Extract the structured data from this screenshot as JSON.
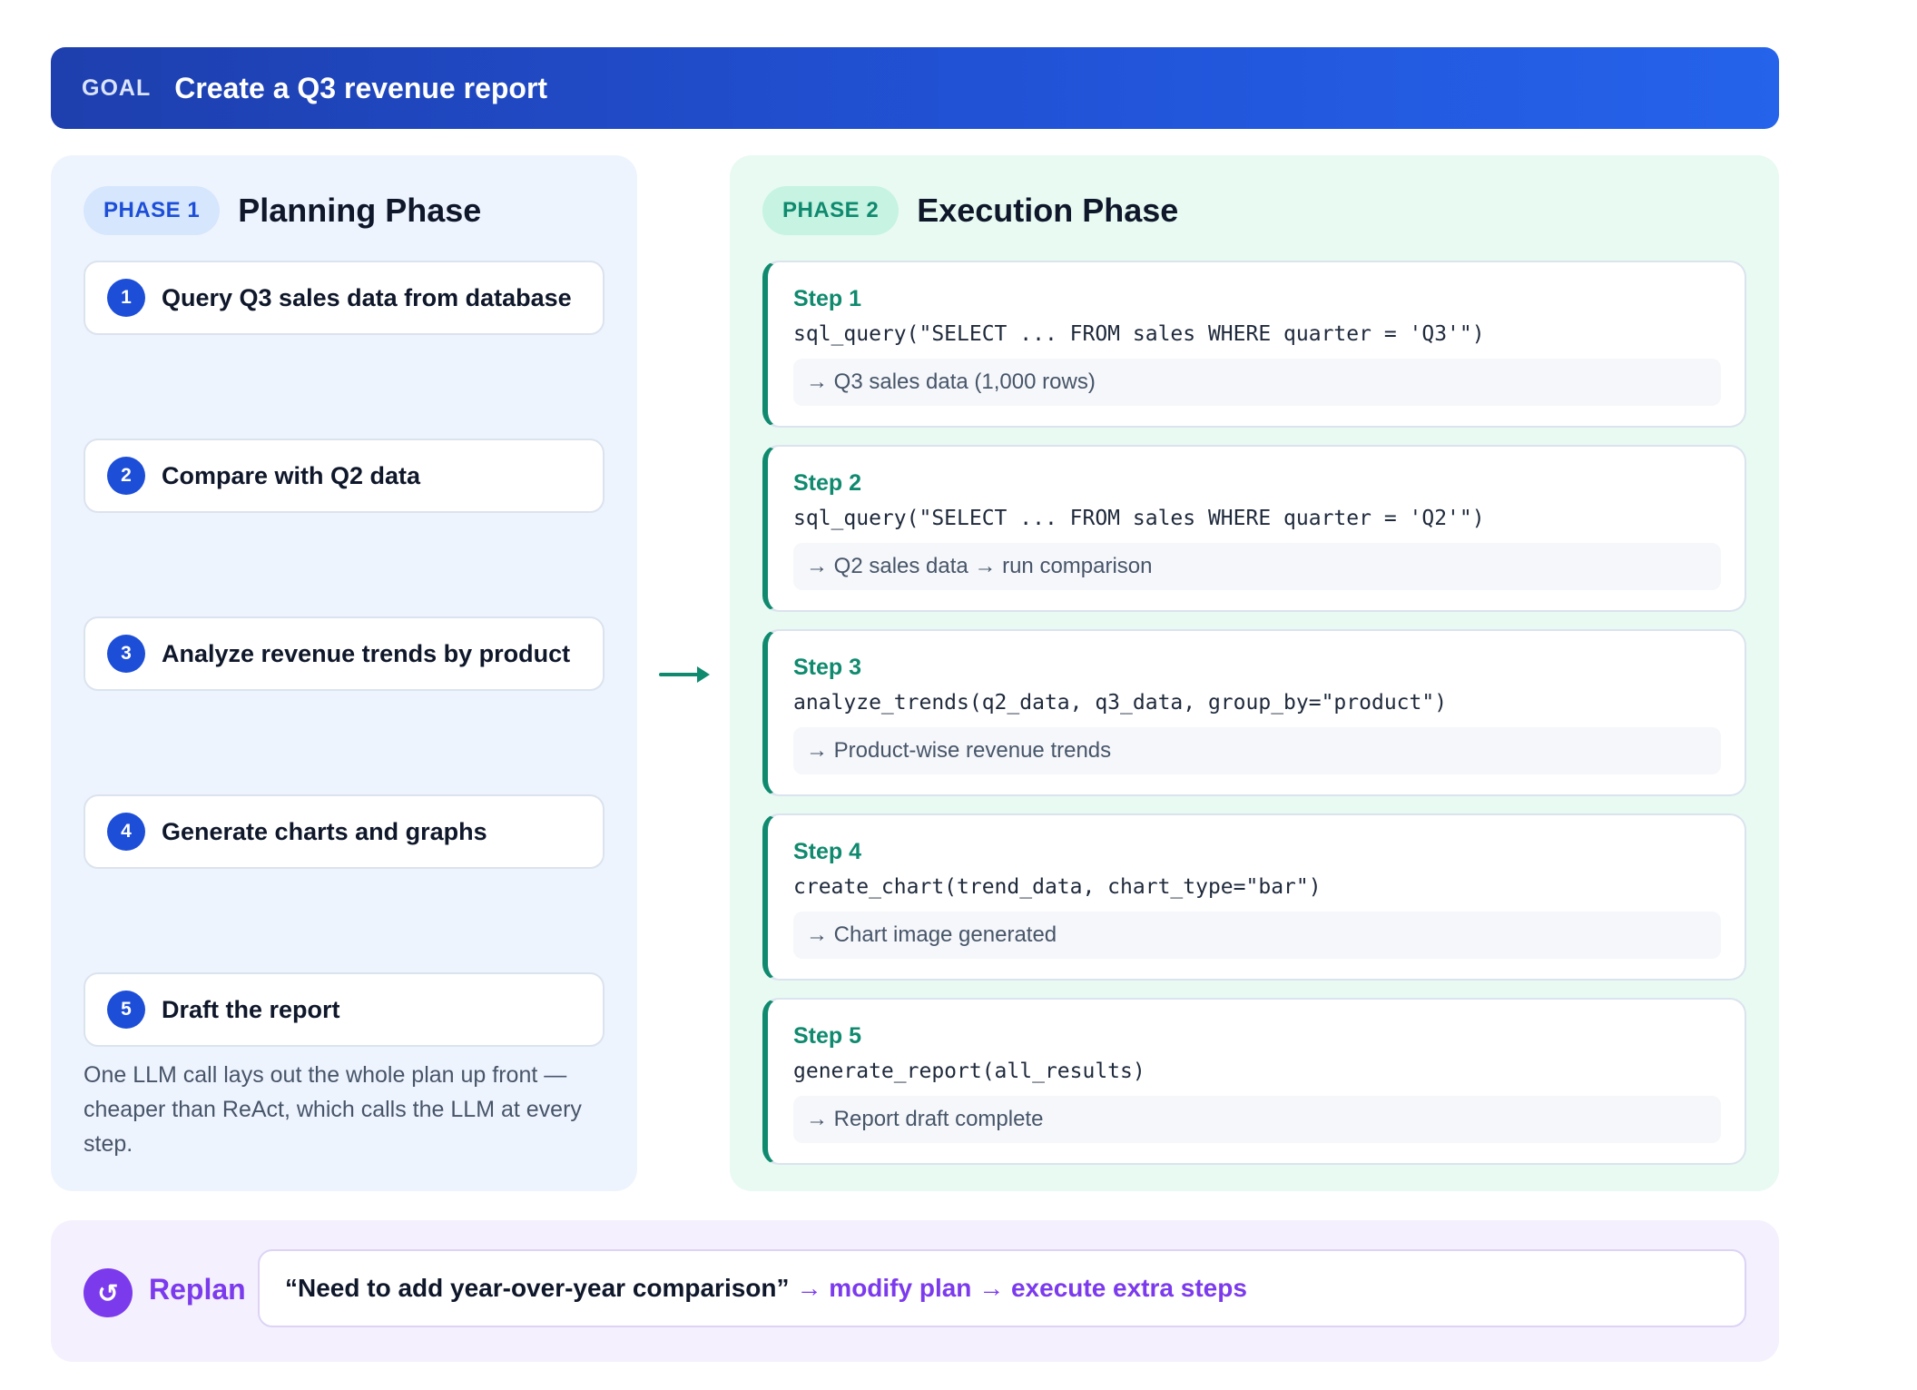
{
  "goal": {
    "tag": "GOAL",
    "text": "Create a Q3 revenue report"
  },
  "planning": {
    "badge": "PHASE 1",
    "title": "Planning Phase",
    "steps": [
      {
        "num": "1",
        "label": "Query Q3 sales data from database"
      },
      {
        "num": "2",
        "label": "Compare with Q2 data"
      },
      {
        "num": "3",
        "label": "Analyze revenue trends by product"
      },
      {
        "num": "4",
        "label": "Generate charts and graphs"
      },
      {
        "num": "5",
        "label": "Draft the report"
      }
    ],
    "note": "One LLM call lays out the whole plan up front — cheaper than ReAct, which calls the LLM at every step."
  },
  "execution": {
    "badge": "PHASE 2",
    "title": "Execution Phase",
    "steps": [
      {
        "label": "Step 1",
        "code": "sql_query(\"SELECT ... FROM sales WHERE quarter = 'Q3'\")",
        "result": "→ Q3 sales data (1,000 rows)"
      },
      {
        "label": "Step 2",
        "code": "sql_query(\"SELECT ... FROM sales WHERE quarter = 'Q2'\")",
        "result": "→ Q2 sales data → run comparison"
      },
      {
        "label": "Step 3",
        "code": "analyze_trends(q2_data, q3_data, group_by=\"product\")",
        "result": "→ Product-wise revenue trends"
      },
      {
        "label": "Step 4",
        "code": "create_chart(trend_data, chart_type=\"bar\")",
        "result": "→ Chart image generated"
      },
      {
        "label": "Step 5",
        "code": "generate_report(all_results)",
        "result": "→ Report draft complete"
      }
    ]
  },
  "replan": {
    "icon": "↺",
    "label": "Replan",
    "quote": "“Need to add year-over-year comparison”",
    "action": "→ modify plan → execute extra steps"
  },
  "colors": {
    "primary_blue": "#1d4ed8",
    "teal": "#0f8a6e",
    "purple": "#7c3aed"
  }
}
